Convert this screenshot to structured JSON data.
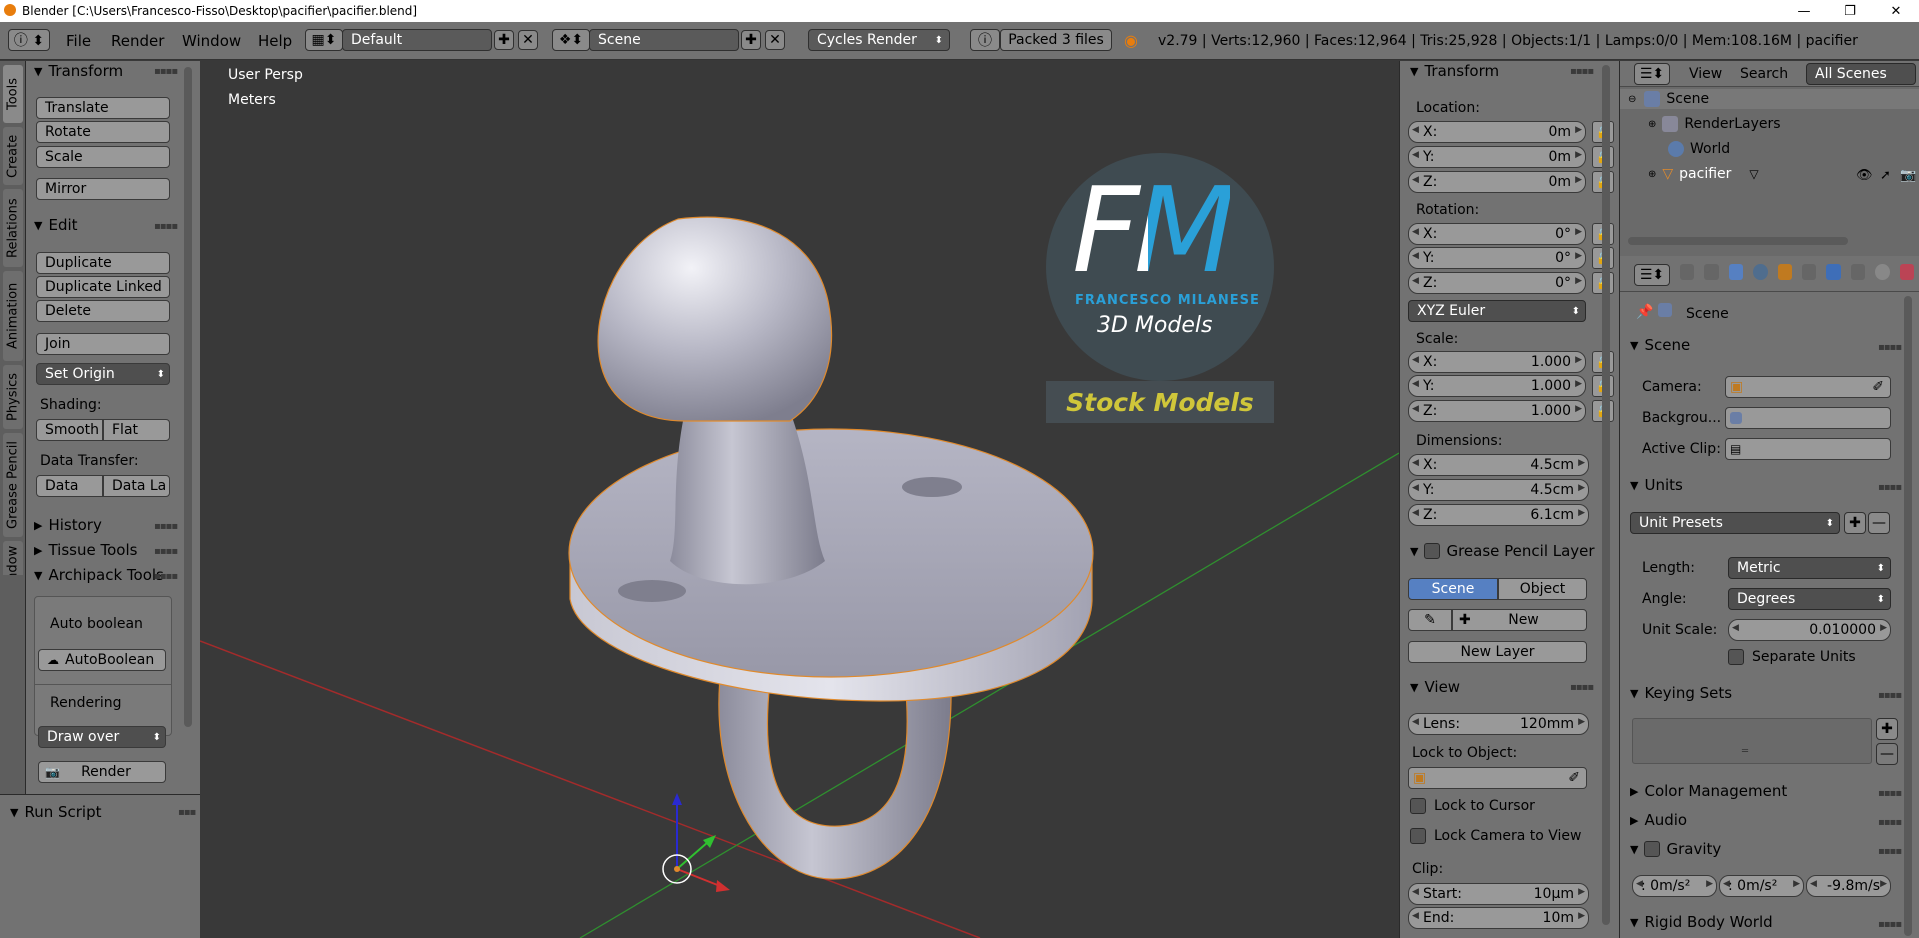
{
  "titlebar": {
    "title": "Blender [C:\\Users\\Francesco-Fisso\\Desktop\\pacifier\\pacifier.blend]",
    "minimize": "—",
    "maximize": "❐",
    "close": "✕"
  },
  "menubar": {
    "menus": [
      "File",
      "Render",
      "Window",
      "Help"
    ],
    "layout": "Default",
    "scene": "Scene",
    "engine": "Cycles Render",
    "packed": "Packed 3 files",
    "stats": "v2.79 | Verts:12,960 | Faces:12,964 | Tris:25,928 | Objects:1/1 | Lamps:0/0 | Mem:108.16M | pacifier"
  },
  "tool_tabs": [
    "Tools",
    "Create",
    "Relations",
    "Animation",
    "Physics",
    "Grease Pencil",
    "Window"
  ],
  "toolshelf": {
    "transform_header": "Transform",
    "translate": "Translate",
    "rotate": "Rotate",
    "scale": "Scale",
    "mirror": "Mirror",
    "edit_header": "Edit",
    "duplicate": "Duplicate",
    "duplicate_linked": "Duplicate Linked",
    "delete": "Delete",
    "join": "Join",
    "set_origin": "Set Origin",
    "shading_label": "Shading:",
    "smooth": "Smooth",
    "flat": "Flat",
    "data_transfer_label": "Data Transfer:",
    "data": "Data",
    "data_la": "Data La",
    "history": "History",
    "tissue_tools": "Tissue Tools",
    "archipack_tools": "Archipack Tools",
    "auto_boolean_label": "Auto boolean",
    "autoboolean_button": "AutoBoolean",
    "rendering_label": "Rendering",
    "draw_over": "Draw over",
    "render_button": "Render"
  },
  "run_script": "Run Script",
  "viewport": {
    "view_label": "User Persp",
    "units_label": "Meters",
    "logo_initials": "FM",
    "logo_name": "FRANCESCO MILANESE",
    "logo_tag": "3D Models",
    "stock_label": "Stock Models"
  },
  "npanel": {
    "transform_header": "Transform",
    "location_label": "Location:",
    "loc": [
      {
        "k": "X:",
        "v": "0m"
      },
      {
        "k": "Y:",
        "v": "0m"
      },
      {
        "k": "Z:",
        "v": "0m"
      }
    ],
    "rotation_label": "Rotation:",
    "rot": [
      {
        "k": "X:",
        "v": "0°"
      },
      {
        "k": "Y:",
        "v": "0°"
      },
      {
        "k": "Z:",
        "v": "0°"
      }
    ],
    "rotation_mode": "XYZ Euler",
    "scale_label": "Scale:",
    "scl": [
      {
        "k": "X:",
        "v": "1.000"
      },
      {
        "k": "Y:",
        "v": "1.000"
      },
      {
        "k": "Z:",
        "v": "1.000"
      }
    ],
    "dimensions_label": "Dimensions:",
    "dim": [
      {
        "k": "X:",
        "v": "4.5cm"
      },
      {
        "k": "Y:",
        "v": "4.5cm"
      },
      {
        "k": "Z:",
        "v": "6.1cm"
      }
    ],
    "grease_pencil_header": "Grease Pencil Layer",
    "gp_scene": "Scene",
    "gp_object": "Object",
    "gp_new": "New",
    "gp_new_layer": "New Layer",
    "view_header": "View",
    "lens_label": "Lens:",
    "lens_value": "120mm",
    "lock_to_object_label": "Lock to Object:",
    "lock_to_cursor": "Lock to Cursor",
    "lock_camera_to_view": "Lock Camera to View",
    "clip_label": "Clip:",
    "clip_start_label": "Start:",
    "clip_start_value": "10µm",
    "clip_end_label": "End:",
    "clip_end_value": "10m"
  },
  "outliner": {
    "view": "View",
    "search": "Search",
    "all_scenes": "All Scenes",
    "items": [
      "Scene",
      "RenderLayers",
      "World",
      "pacifier"
    ]
  },
  "properties": {
    "context": "Scene",
    "scene_header": "Scene",
    "camera_label": "Camera:",
    "background_label": "Backgrou...",
    "active_clip_label": "Active Clip:",
    "units_header": "Units",
    "unit_presets": "Unit Presets",
    "length_label": "Length:",
    "length_value": "Metric",
    "angle_label": "Angle:",
    "angle_value": "Degrees",
    "unit_scale_label": "Unit Scale:",
    "unit_scale_value": "0.010000",
    "separate_units": "Separate Units",
    "keying_sets_header": "Keying Sets",
    "color_management_header": "Color Management",
    "audio_header": "Audio",
    "gravity_header": "Gravity",
    "gravity_values": [
      ": 0m/s²",
      ": 0m/s²",
      "-9.8m/s"
    ],
    "rigid_body_header": "Rigid Body World"
  }
}
